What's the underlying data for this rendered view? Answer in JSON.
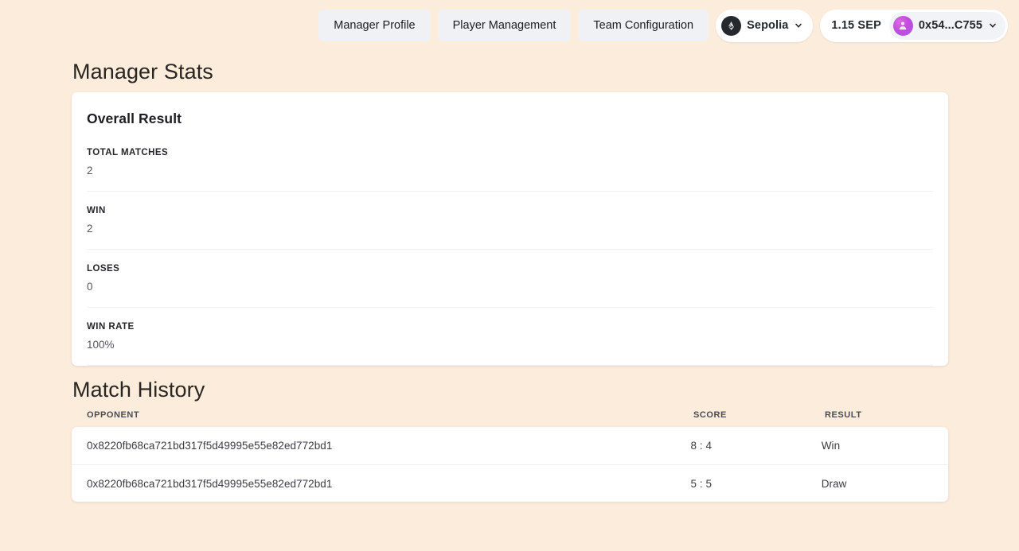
{
  "nav": {
    "tabs": [
      {
        "label": "Manager Profile"
      },
      {
        "label": "Player Management"
      },
      {
        "label": "Team Configuration"
      }
    ]
  },
  "wallet": {
    "network_icon": "ethereum-icon",
    "network_name": "Sepolia",
    "network_chevron": "chevron-down-icon",
    "balance": "1.15 SEP",
    "avatar_icon": "account-avatar",
    "address": "0x54...C755",
    "account_chevron": "chevron-down-icon",
    "accent_color": "#a855e8",
    "badge_color": "#25292e"
  },
  "manager_stats": {
    "section_title": "Manager Stats",
    "card_heading": "Overall Result",
    "rows": [
      {
        "label": "TOTAL MATCHES",
        "value": "2"
      },
      {
        "label": "WIN",
        "value": "2"
      },
      {
        "label": "LOSES",
        "value": "0"
      },
      {
        "label": "WIN RATE",
        "value": "100%"
      }
    ]
  },
  "match_history": {
    "section_title": "Match History",
    "columns": {
      "opponent": "OPPONENT",
      "score": "SCORE",
      "result": "RESULT"
    },
    "rows": [
      {
        "opponent": "0x8220fb68ca721bd317f5d49995e55e82ed772bd1",
        "score": "8 : 4",
        "result": "Win"
      },
      {
        "opponent": "0x8220fb68ca721bd317f5d49995e55e82ed772bd1",
        "score": "5 : 5",
        "result": "Draw"
      }
    ]
  },
  "theme": {
    "background": "#fbecdc",
    "card": "#ffffff",
    "tab_background": "#f0f1f5"
  }
}
